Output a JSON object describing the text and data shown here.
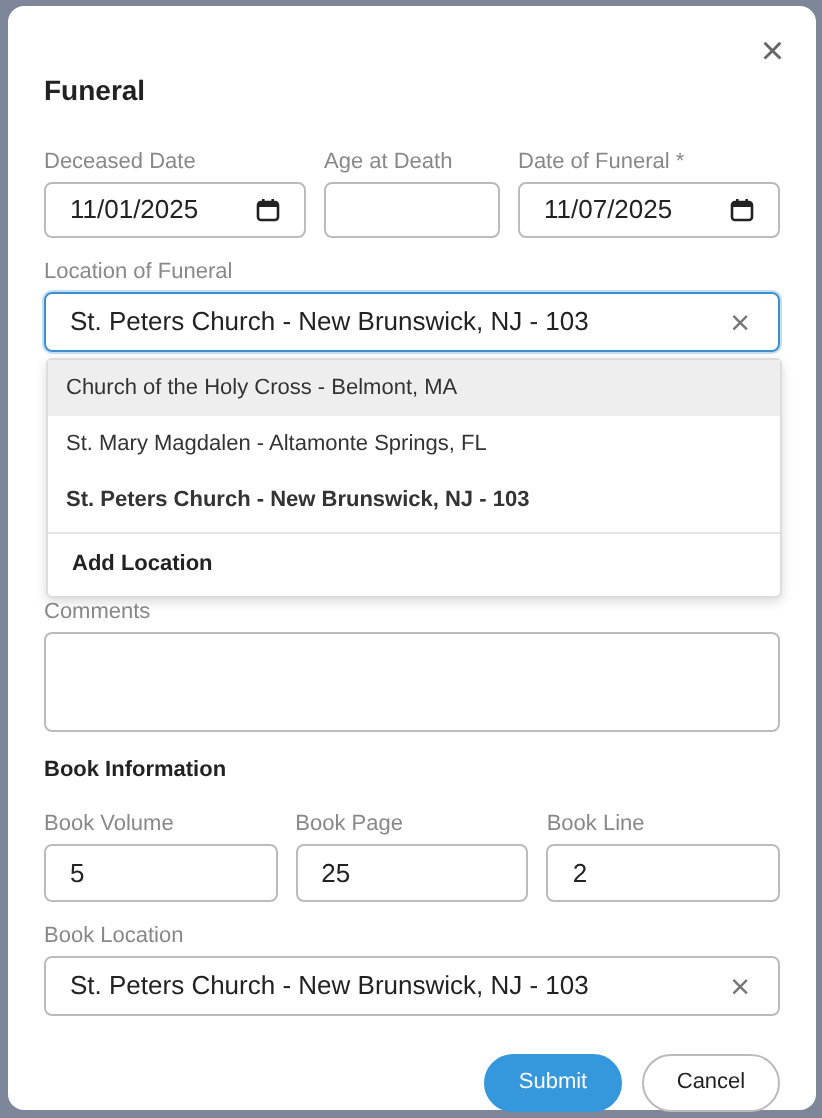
{
  "dialog": {
    "title": "Funeral",
    "close": "×"
  },
  "date_row": [
    {
      "kind": "date",
      "label": "Deceased Date",
      "value": "11/01/2025"
    },
    {
      "kind": "text",
      "label": "Age at Death"
    },
    {
      "kind": "date",
      "label": "Date of Funeral *",
      "value": "11/07/2025"
    }
  ],
  "location": {
    "label": "Location of Funeral",
    "value": "St. Peters Church - New Brunswick, NJ - 103",
    "focused": true,
    "clear": "×"
  },
  "location_dropdown": {
    "options": [
      {
        "label": "Church of the Holy Cross - Belmont, MA",
        "highlighted": true,
        "selected": false
      },
      {
        "label": "St. Mary Magdalen - Altamonte Springs, FL",
        "highlighted": false,
        "selected": false
      },
      {
        "label": "St. Peters Church - New Brunswick, NJ - 103",
        "highlighted": false,
        "selected": true
      }
    ],
    "action": "Add Location"
  },
  "comments": {
    "label": "Comments"
  },
  "book_information": {
    "heading": "Book Information",
    "fields": [
      {
        "label": "Book Volume",
        "value": "5"
      },
      {
        "label": "Book Page",
        "value": "25"
      },
      {
        "label": "Book Line",
        "value": "2"
      }
    ],
    "location": {
      "label": "Book Location",
      "value": "St. Peters Church - New Brunswick, NJ - 103",
      "focused": false,
      "clear": "×"
    }
  },
  "buttons": [
    {
      "kind": "primary",
      "label": "Submit"
    },
    {
      "kind": "secondary",
      "label": "Cancel"
    }
  ]
}
